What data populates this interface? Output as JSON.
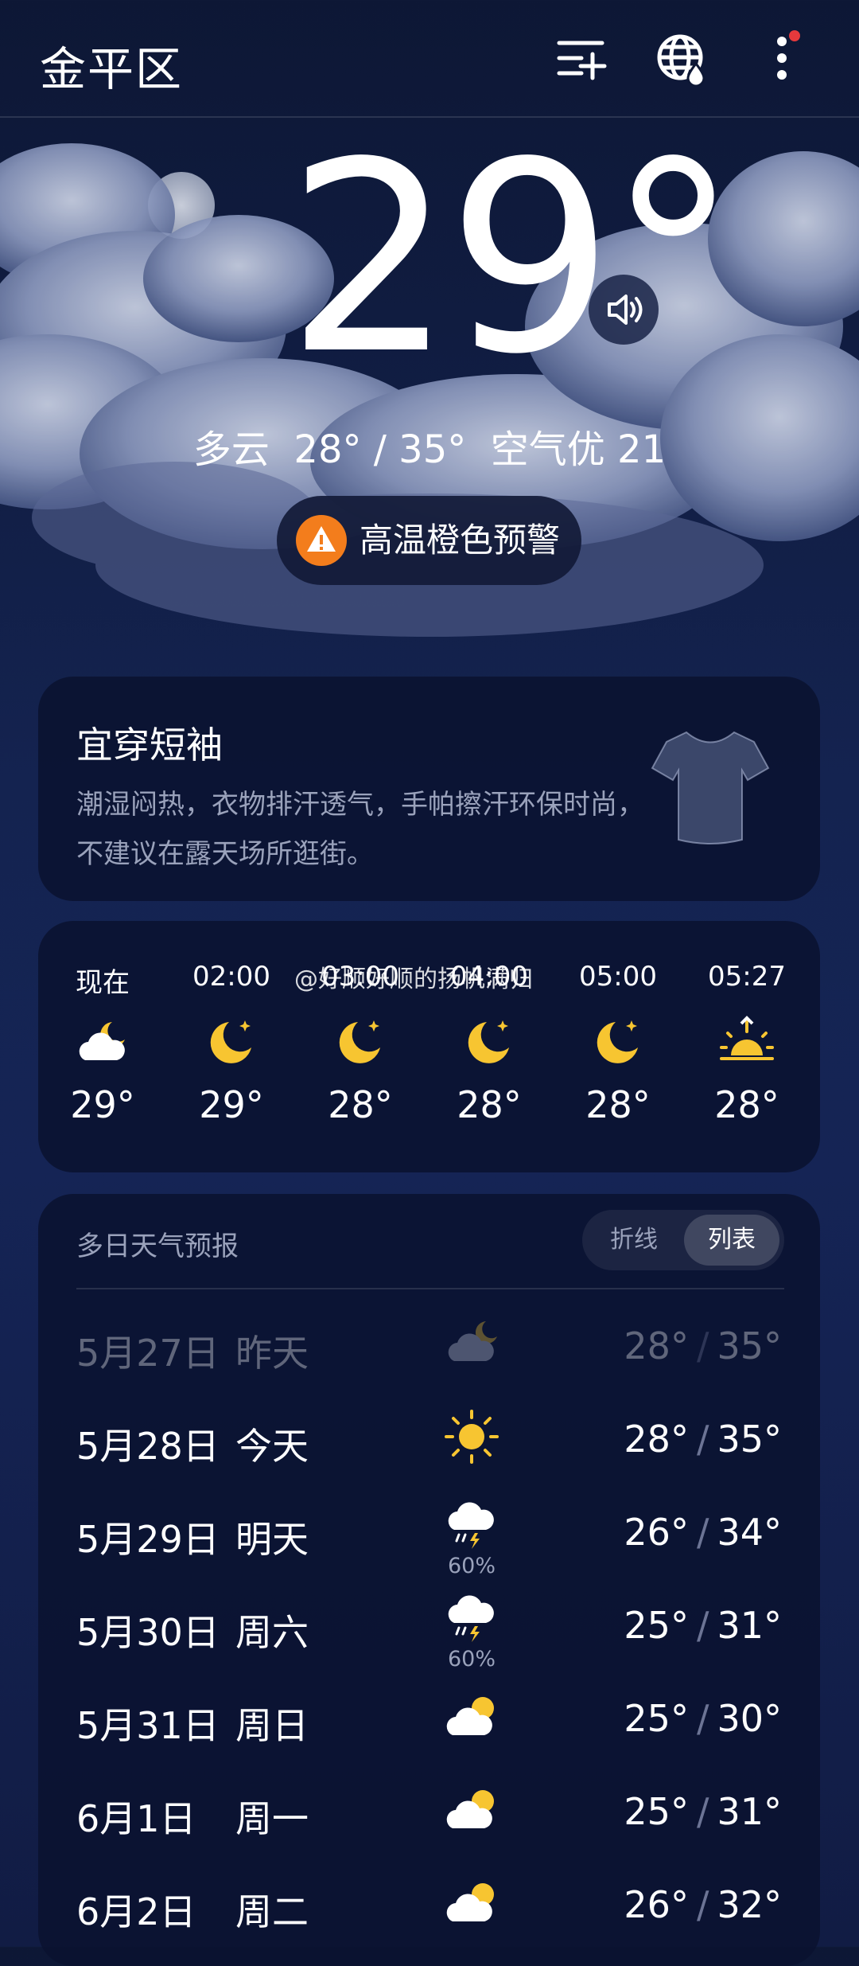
{
  "header": {
    "city": "金平区"
  },
  "current": {
    "temperature": "29°",
    "condition": "多云",
    "range": "28° / 35°",
    "air": "空气优 21",
    "alert": "高温橙色预警"
  },
  "clothing": {
    "title": "宜穿短袖",
    "desc": "潮湿闷热，衣物排汗透气，手帕擦汗环保时尚，不建议在露天场所逛街。"
  },
  "hourly": [
    {
      "time": "现在",
      "temp": "29°",
      "icon": "partly-cloudy-night-icon"
    },
    {
      "time": "02:00",
      "temp": "29°",
      "icon": "moon-icon"
    },
    {
      "time": "03:00",
      "temp": "28°",
      "icon": "moon-icon"
    },
    {
      "time": "04:00",
      "temp": "28°",
      "icon": "moon-icon"
    },
    {
      "time": "05:00",
      "temp": "28°",
      "icon": "moon-icon"
    },
    {
      "time": "05:27",
      "temp": "28°",
      "icon": "sunrise-icon"
    }
  ],
  "watermark": "@好顺好顺的扬帆满归",
  "forecast": {
    "title": "多日天气预报",
    "toggle": [
      "折线",
      "列表"
    ],
    "active_toggle": "列表",
    "days": [
      {
        "date": "5月27日",
        "day": "昨天",
        "low": "28°",
        "high": "35°",
        "icon": "cloudy-night-icon",
        "pct": ""
      },
      {
        "date": "5月28日",
        "day": "今天",
        "low": "28°",
        "high": "35°",
        "icon": "sun-icon",
        "pct": ""
      },
      {
        "date": "5月29日",
        "day": "明天",
        "low": "26°",
        "high": "34°",
        "icon": "thunderstorm-icon",
        "pct": "60%"
      },
      {
        "date": "5月30日",
        "day": "周六",
        "low": "25°",
        "high": "31°",
        "icon": "thunderstorm-icon",
        "pct": "60%"
      },
      {
        "date": "5月31日",
        "day": "周日",
        "low": "25°",
        "high": "30°",
        "icon": "partly-cloudy-day-icon",
        "pct": ""
      },
      {
        "date": "6月1日",
        "day": "周一",
        "low": "25°",
        "high": "31°",
        "icon": "partly-cloudy-day-icon",
        "pct": ""
      },
      {
        "date": "6月2日",
        "day": "周二",
        "low": "26°",
        "high": "32°",
        "icon": "partly-cloudy-day-icon",
        "pct": ""
      }
    ]
  },
  "colors": {
    "accent_orange": "#f37d1c",
    "moon_yellow": "#f7c531",
    "notify_red": "#e5393c"
  }
}
